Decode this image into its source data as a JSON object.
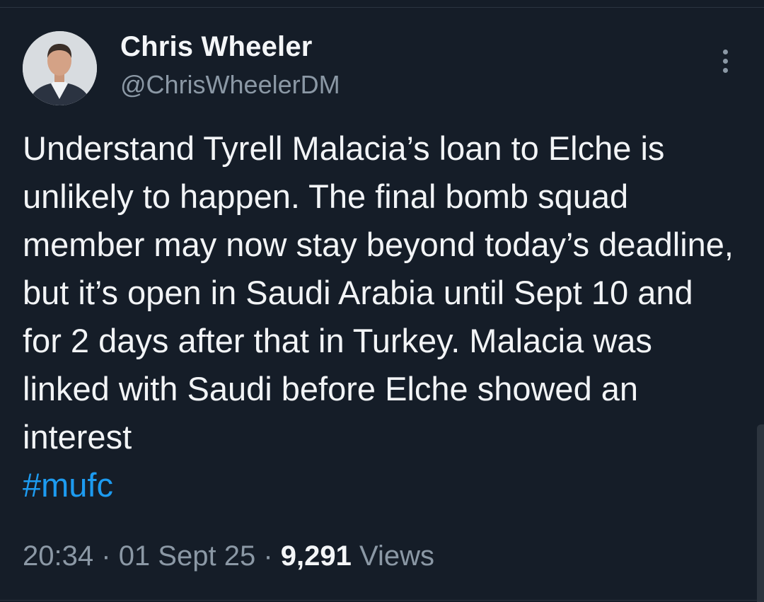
{
  "tweet": {
    "author": {
      "display_name": "Chris Wheeler",
      "handle": "@ChrisWheelerDM",
      "avatar_icon": "profile-photo"
    },
    "more_icon": "more-vertical-icon",
    "text": "Understand Tyrell Malacia’s loan to Elche is unlikely to happen. The final bomb squad member may now stay beyond today’s deadline, but it’s open in Saudi Arabia until Sept 10 and for 2 days after that in Turkey. Malacia was linked with Saudi before Elche showed an interest",
    "hashtag": "#mufc",
    "time": "20:34",
    "separator": "·",
    "date": "01 Sept 25",
    "views_count": "9,291",
    "views_label": "Views"
  },
  "colors": {
    "background": "#151d28",
    "text": "#f2f4f6",
    "secondary_text": "#8b98a5",
    "link": "#1d9bf0"
  }
}
